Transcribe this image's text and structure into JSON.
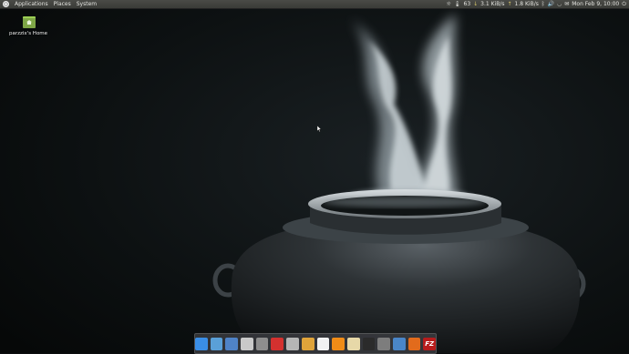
{
  "top_panel": {
    "menus": [
      "Applications",
      "Places",
      "System"
    ],
    "tray": {
      "brightness_icon": "brightness-icon",
      "temperature": "63",
      "temperature_icon": "thermometer-icon",
      "net_down": "3.1 KiB/s",
      "net_up": "1.8 KiB/s",
      "bluetooth_icon": "bluetooth-icon",
      "volume_icon": "volume-icon",
      "wifi_icon": "wifi-icon",
      "mail_icon": "mail-icon",
      "datetime": "Mon Feb 9, 10:00",
      "power_icon": "power-icon"
    }
  },
  "desktop": {
    "icons": [
      {
        "label": "parzzix's Home",
        "icon": "home-folder-icon"
      }
    ]
  },
  "dock": {
    "items": [
      {
        "name": "finder",
        "icon": "finder-icon",
        "color": "#3a8ee6"
      },
      {
        "name": "browser",
        "icon": "globe-icon",
        "color": "#5aa0d8"
      },
      {
        "name": "thunderbird",
        "icon": "mail-app-icon",
        "color": "#4f83c7"
      },
      {
        "name": "drive",
        "icon": "drive-icon",
        "color": "#c9c9c9"
      },
      {
        "name": "files",
        "icon": "files-icon",
        "color": "#8e8e8e"
      },
      {
        "name": "pdf-reader",
        "icon": "pdf-icon",
        "color": "#d4312f"
      },
      {
        "name": "storage",
        "icon": "storage-icon",
        "color": "#b5b5b5"
      },
      {
        "name": "monitor",
        "icon": "monitor-icon",
        "color": "#e0a43a"
      },
      {
        "name": "text-editor",
        "icon": "text-editor-icon",
        "color": "#f2f2f2"
      },
      {
        "name": "vlc",
        "icon": "vlc-icon",
        "color": "#f08c17"
      },
      {
        "name": "image-viewer",
        "icon": "image-viewer-icon",
        "color": "#e7d8a8"
      },
      {
        "name": "terminal",
        "icon": "terminal-icon",
        "color": "#2b2b2b"
      },
      {
        "name": "steam",
        "icon": "steam-icon",
        "color": "#7d7d7d"
      },
      {
        "name": "screenshot",
        "icon": "screenshot-icon",
        "color": "#4a86c8"
      },
      {
        "name": "xchat",
        "icon": "xchat-icon",
        "color": "#e26b1c"
      },
      {
        "name": "filezilla",
        "icon": "filezilla-icon",
        "color": "#b71c1c",
        "text": "FZ"
      }
    ]
  }
}
